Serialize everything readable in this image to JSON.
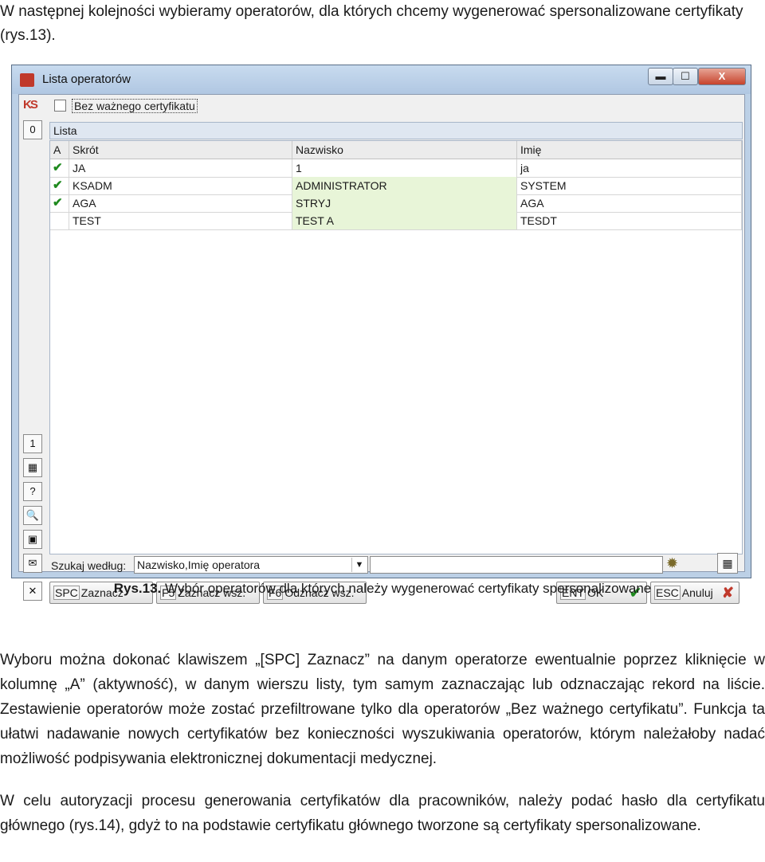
{
  "intro": "W następnej kolejności wybieramy operatorów, dla których chcemy wygenerować spersonalizowane certyfikaty (rys.13).",
  "window": {
    "title": "Lista operatorów",
    "min_label": "▬",
    "max_label": "☐",
    "close_label": "X",
    "logo_text": "KS",
    "checkbox_label": "Bez ważnego certyfikatu",
    "list_label": "Lista",
    "zero_btn": "0",
    "columns": [
      "A",
      "Skrót",
      "Nazwisko",
      "Imię"
    ],
    "rows": [
      {
        "active": "✔",
        "code": "JA",
        "surname": "1",
        "name": "ja"
      },
      {
        "active": "✔",
        "code": "KSADM",
        "surname": "ADMINISTRATOR",
        "name": "SYSTEM"
      },
      {
        "active": "✔",
        "code": "AGA",
        "surname": "STRYJ",
        "name": "AGA"
      },
      {
        "active": "",
        "code": "TEST",
        "surname": "TEST A",
        "name": "TESDT"
      }
    ],
    "left_tools": [
      "1",
      "▦",
      "?",
      "🔍",
      "▣",
      "✉",
      "✕"
    ],
    "search_label": "Szukaj według:",
    "search_mode": "Nazwisko,Imię operatora",
    "search_value": "",
    "buttons": {
      "spc_key": "SPC",
      "spc_label": "Zaznacz",
      "f5_key": "F5",
      "f5_label": "Zaznacz wsz.",
      "f6_key": "F6",
      "f6_label": "Odznacz wsz.",
      "ent_key": "ENT",
      "ent_label": "OK",
      "esc_key": "ESC",
      "esc_label": "Anuluj"
    }
  },
  "caption_bold": "Rys.13.",
  "caption_text": " Wybór operatorów dla których należy wygenerować certyfikaty spersonalizowane",
  "paragraph1": "Wyboru można dokonać klawiszem „[SPC] Zaznacz” na danym operatorze ewentualnie poprzez kliknięcie w kolumnę „A” (aktywność), w danym wierszu listy, tym samym zaznaczając lub odznaczając rekord na liście. Zestawienie operatorów może zostać przefiltrowane tylko dla operatorów „Bez ważnego certyfikatu”. Funkcja ta ułatwi nadawanie nowych certyfikatów bez konieczności wyszukiwania operatorów, którym należałoby nadać możliwość podpisywania elektronicznej dokumentacji medycznej.",
  "paragraph2": "W celu autoryzacji procesu generowania certyfikatów dla pracowników, należy podać hasło dla certyfikatu głównego (rys.14), gdyż to na podstawie certyfikatu głównego tworzone są certyfikaty spersonalizowane."
}
